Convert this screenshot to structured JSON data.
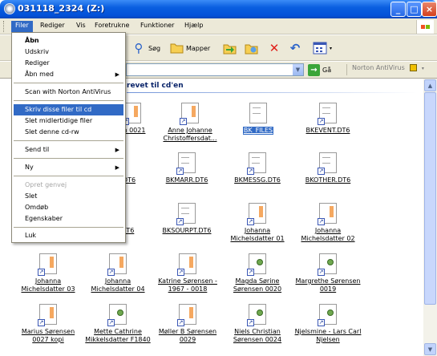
{
  "window": {
    "title": "031118_2324 (Z:)"
  },
  "menubar": [
    {
      "label": "Filer",
      "active": true
    },
    {
      "label": "Rediger"
    },
    {
      "label": "Vis"
    },
    {
      "label": "Foretrukne"
    },
    {
      "label": "Funktioner"
    },
    {
      "label": "Hjælp"
    }
  ],
  "toolbar": {
    "search_label": "Søg",
    "folders_label": "Mapper"
  },
  "addressbar": {
    "go_label": "Gå",
    "norton_label": "Norton AntiVirus"
  },
  "content": {
    "section_title": "revet til cd'en",
    "files": [
      {
        "label": "en 0021",
        "icon": "document-shortcut-icon"
      },
      {
        "label": "Anne Johanne Christoffersdat...",
        "icon": "document-shortcut-icon"
      },
      {
        "label": "BK_FILES",
        "icon": "text-file-icon",
        "selected": true
      },
      {
        "label": "BKEVENT.DT6",
        "icon": "document-shortcut-icon"
      },
      {
        "label": "DT6",
        "icon": "document-shortcut-icon"
      },
      {
        "label": "BKMARR.DT6",
        "icon": "document-shortcut-icon"
      },
      {
        "label": "BKMESSG.DT6",
        "icon": "document-shortcut-icon"
      },
      {
        "label": "BKOTHER.DT6",
        "icon": "document-shortcut-icon"
      },
      {
        "label": ".DT6",
        "icon": "document-shortcut-icon"
      },
      {
        "label": "BKSOURPT.DT6",
        "icon": "document-shortcut-icon"
      },
      {
        "label": "Johanna Michelsdatter 01",
        "icon": "document-shortcut-icon"
      },
      {
        "label": "Johanna Michelsdatter 02",
        "icon": "document-shortcut-icon"
      },
      {
        "label": "Johanna Michelsdatter 03",
        "icon": "document-shortcut-icon"
      },
      {
        "label": "Johanna Michelsdatter 04",
        "icon": "document-shortcut-icon"
      },
      {
        "label": "Katrine Sørensen - 1967 - 0018",
        "icon": "document-shortcut-icon"
      },
      {
        "label": "Magda Sørine Sørensen 0020",
        "icon": "program-shortcut-icon"
      },
      {
        "label": "Margrethe Sørensen 0019",
        "icon": "program-shortcut-icon"
      },
      {
        "label": "Marius Sørensen 0027 kopi",
        "icon": "document-shortcut-icon"
      },
      {
        "label": "Mette Cathrine Mikkelsdatter F1840",
        "icon": "program-shortcut-icon"
      },
      {
        "label": "Møller B Sørensen 0029",
        "icon": "document-shortcut-icon"
      },
      {
        "label": "Niels Christian Sørensen 0024",
        "icon": "program-shortcut-icon"
      },
      {
        "label": "Njelsmine - Lars Carl Njelsen",
        "icon": "program-shortcut-icon"
      }
    ]
  },
  "file_menu": {
    "items": [
      {
        "label": "Åbn",
        "bold": true
      },
      {
        "label": "Udskriv"
      },
      {
        "label": "Rediger"
      },
      {
        "label": "Åbn med",
        "submenu": true
      },
      {
        "separator": true
      },
      {
        "label": "Scan with Norton AntiVirus"
      },
      {
        "separator": true
      },
      {
        "label": "Skriv disse filer til cd",
        "highlighted": true
      },
      {
        "label": "Slet midlertidige filer"
      },
      {
        "label": "Slet denne cd-rw"
      },
      {
        "separator": true
      },
      {
        "label": "Send til",
        "submenu": true
      },
      {
        "separator": true
      },
      {
        "label": "Ny",
        "submenu": true
      },
      {
        "separator": true
      },
      {
        "label": "Opret genvej",
        "disabled": true
      },
      {
        "label": "Slet"
      },
      {
        "label": "Omdøb"
      },
      {
        "label": "Egenskaber"
      },
      {
        "separator": true
      },
      {
        "label": "Luk"
      }
    ]
  },
  "colors": {
    "titlebar": "#0a5fe0",
    "highlight": "#316ac5",
    "chrome": "#ece9d8"
  }
}
